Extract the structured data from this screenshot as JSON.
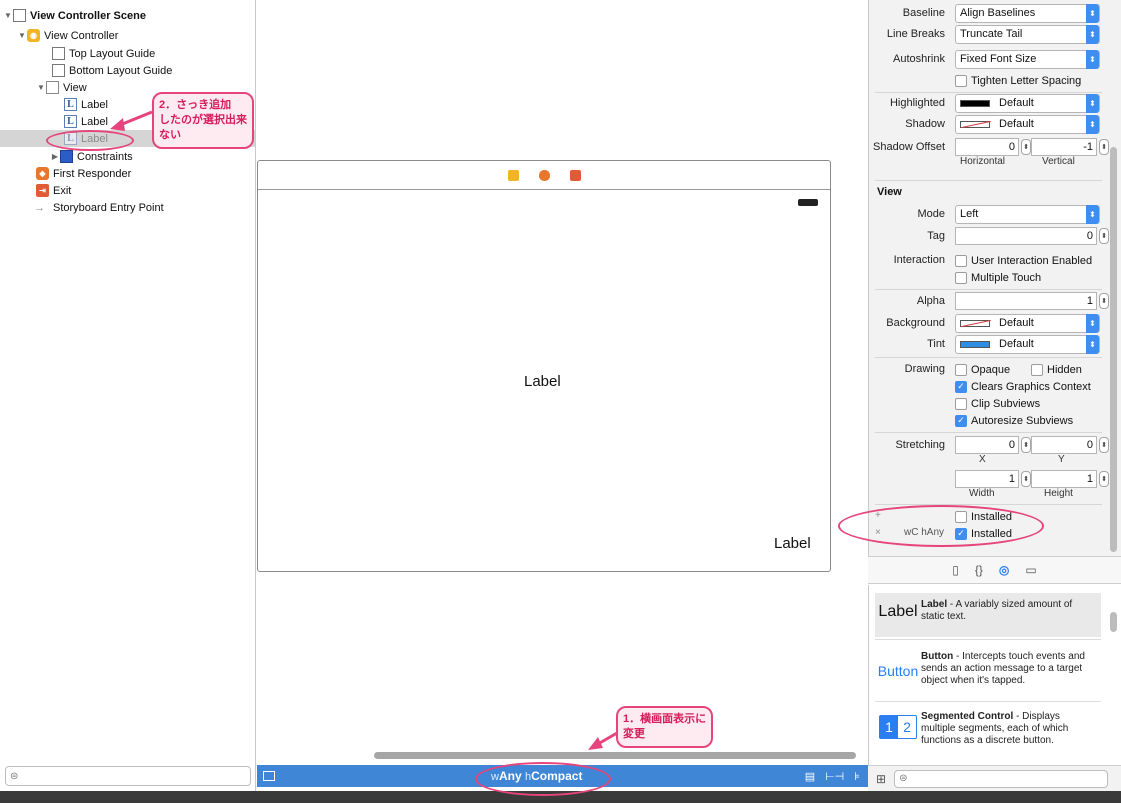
{
  "outline": {
    "items": [
      {
        "label": "View Controller Scene"
      },
      {
        "label": "View Controller"
      },
      {
        "label": "Top Layout Guide"
      },
      {
        "label": "Bottom Layout Guide"
      },
      {
        "label": "View"
      },
      {
        "label": "Label"
      },
      {
        "label": "Label"
      },
      {
        "label": "Label"
      },
      {
        "label": "Constraints"
      },
      {
        "label": "First Responder"
      },
      {
        "label": "Exit"
      },
      {
        "label": "Storyboard Entry Point"
      }
    ],
    "label_icon_glyph": "L",
    "filter_icon": "⊜"
  },
  "canvas": {
    "labels": [
      "Label",
      "Label"
    ]
  },
  "bottom_bar": {
    "size_class": {
      "w_prefix": "w",
      "w_value": "Any",
      "h_prefix": "h",
      "h_value": "Compact"
    },
    "icons": [
      "pin-icon",
      "align-icon",
      "resolve-icon"
    ]
  },
  "inspector": {
    "label_props": {
      "baseline_label": "Baseline",
      "baseline_value": "Align Baselines",
      "linebreaks_label": "Line Breaks",
      "linebreaks_value": "Truncate Tail",
      "autoshrink_label": "Autoshrink",
      "autoshrink_value": "Fixed Font Size",
      "tighten_label": "Tighten Letter Spacing",
      "highlighted_label": "Highlighted",
      "highlighted_value": "Default",
      "shadow_label": "Shadow",
      "shadow_value": "Default",
      "shadow_offset_label": "Shadow Offset",
      "shadow_offset_h": "0",
      "shadow_offset_v": "-1",
      "horizontal_label": "Horizontal",
      "vertical_label": "Vertical"
    },
    "view_section": {
      "title": "View",
      "mode_label": "Mode",
      "mode_value": "Left",
      "tag_label": "Tag",
      "tag_value": "0",
      "interaction_label": "Interaction",
      "user_interaction_label": "User Interaction Enabled",
      "multiple_touch_label": "Multiple Touch",
      "alpha_label": "Alpha",
      "alpha_value": "1",
      "background_label": "Background",
      "background_value": "Default",
      "tint_label": "Tint",
      "tint_value": "Default",
      "drawing_label": "Drawing",
      "opaque_label": "Opaque",
      "hidden_label": "Hidden",
      "clears_label": "Clears Graphics Context",
      "clip_label": "Clip Subviews",
      "autoresize_label": "Autoresize Subviews",
      "stretching_label": "Stretching",
      "stretch_x": "0",
      "stretch_y": "0",
      "stretch_w": "1",
      "stretch_h": "1",
      "x_label": "X",
      "y_label": "Y",
      "width_label": "Width",
      "height_label": "Height"
    },
    "installed": {
      "plus": "+",
      "cross": "×",
      "size_w": "wC",
      "size_h": "hAny",
      "row1_label": "Installed",
      "row2_label": "Installed"
    },
    "checkbox_glyph": "✓"
  },
  "library": {
    "items": [
      {
        "icon_text": "Label",
        "title": "Label",
        "desc": " - A variably sized amount of static text."
      },
      {
        "icon_text": "Button",
        "title": "Button",
        "desc": " - Intercepts touch events and sends an action message to a target object when it's tapped."
      },
      {
        "icon_text": "",
        "title": "Segmented Control",
        "desc": " - Displays multiple segments, each of which functions as a discrete button."
      }
    ],
    "seg_1": "1",
    "seg_2": "2"
  },
  "annotations": {
    "note1": [
      "1．横画面表示に",
      "変更"
    ],
    "note2": [
      "2．さっき追加",
      "したのが選択出来",
      "ない"
    ]
  },
  "colors": {
    "accent": "#3d8ef0",
    "size_bar": "#3f86d6",
    "annotation": "#e5457c"
  }
}
